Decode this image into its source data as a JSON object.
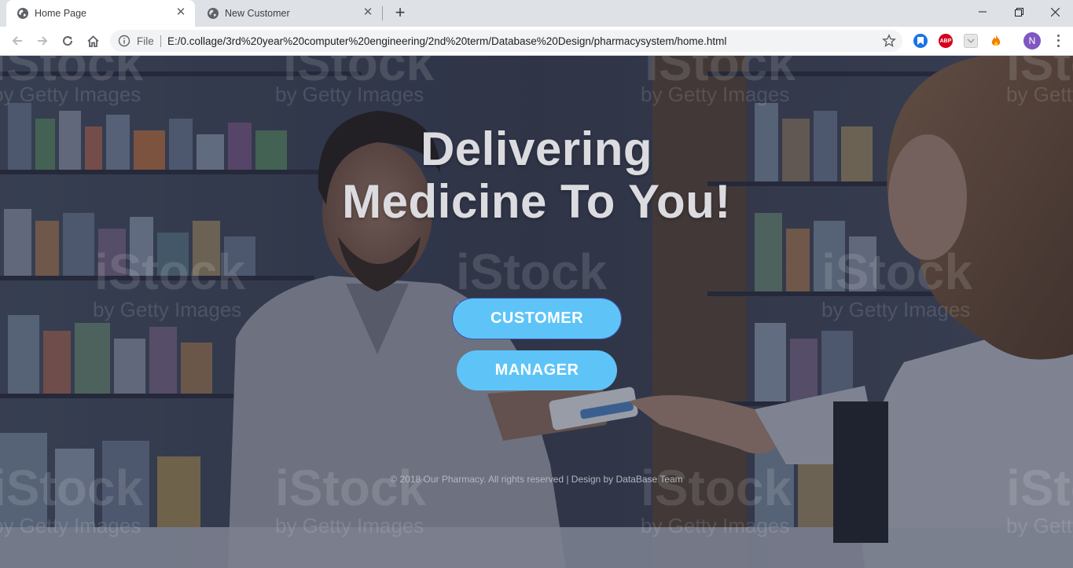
{
  "browser": {
    "tabs": [
      {
        "title": "Home Page",
        "active": true
      },
      {
        "title": "New Customer",
        "active": false
      }
    ],
    "address": {
      "scheme_label": "File",
      "url": "E:/0.collage/3rd%20year%20computer%20engineering/2nd%20term/Database%20Design/pharmacysystem/home.html"
    },
    "extensions": [
      {
        "name": "bookmark-extension-icon",
        "color": "#1a73e8"
      },
      {
        "name": "adblock-plus-icon",
        "label": "ABP",
        "color": "#d5001c"
      },
      {
        "name": "pocket-extension-icon",
        "color": "#c8c8c8"
      },
      {
        "name": "fire-extension-icon",
        "color": "#f57c00"
      }
    ],
    "profile_initial": "N"
  },
  "page": {
    "headline_line1": "Delivering",
    "headline_line2": "Medicine To You!",
    "buttons": {
      "customer": "CUSTOMER",
      "manager": "MANAGER"
    },
    "footer": "© 2018 Our Pharmacy. All rights reserved | Design by DataBase Team",
    "accent_color": "#5ec4f7",
    "watermark": {
      "brand": "iStock",
      "tagline": "by Getty Images"
    }
  }
}
